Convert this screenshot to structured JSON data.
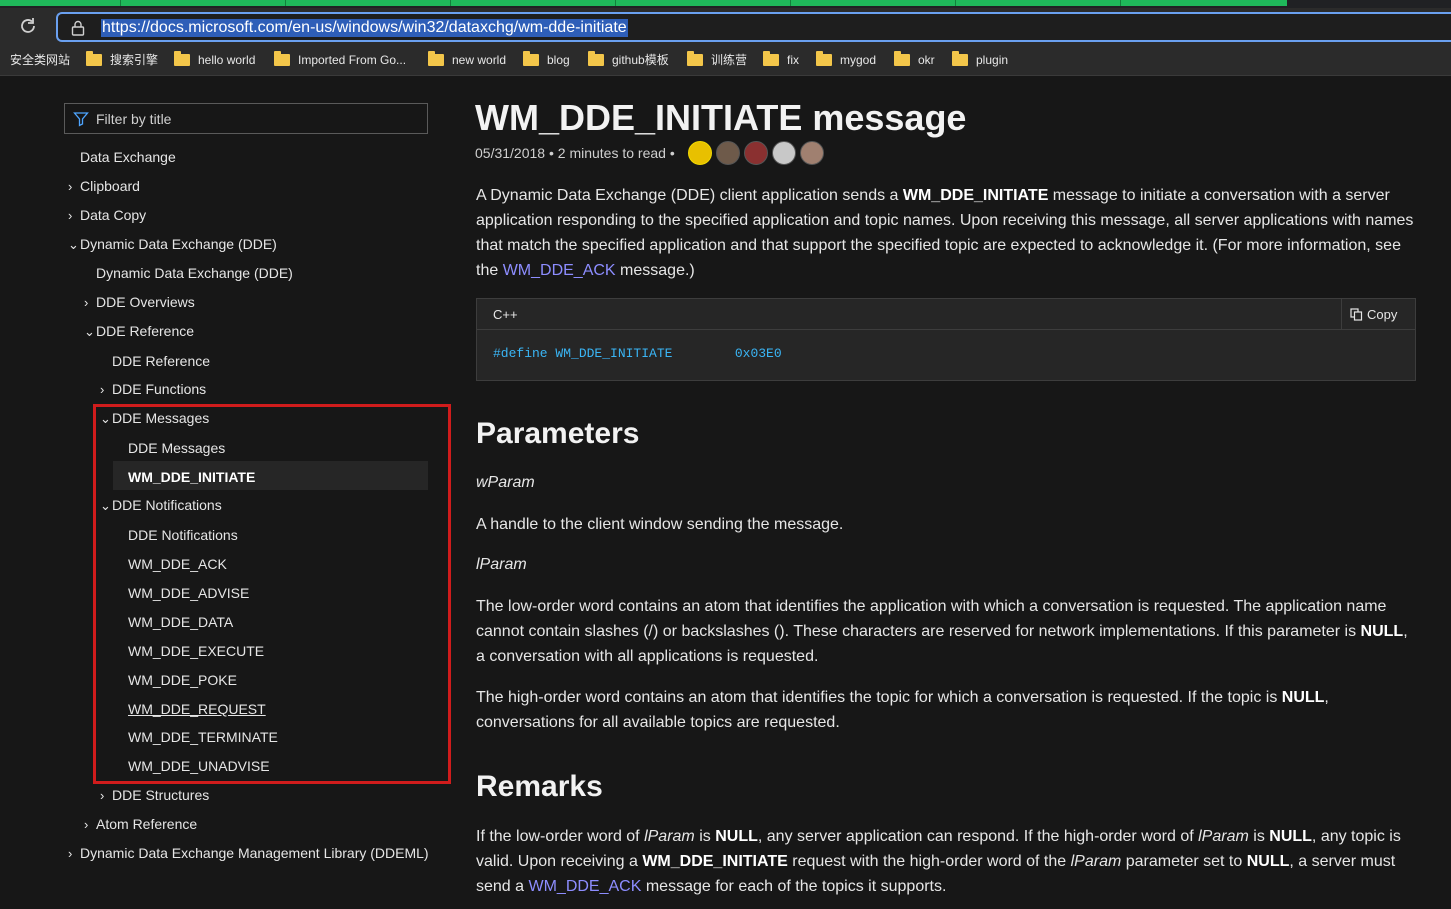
{
  "browser": {
    "url": "https://docs.microsoft.com/en-us/windows/win32/dataxchg/wm-dde-initiate",
    "bookmarks": [
      "安全类网站",
      "搜索引擎",
      "hello world",
      "Imported From Go...",
      "new world",
      "blog",
      "github模板",
      "训练营",
      "fix",
      "mygod",
      "okr",
      "plugin"
    ]
  },
  "sidebar": {
    "filter_placeholder": "Filter by title",
    "items": [
      {
        "label": "Data Exchange",
        "chev": ""
      },
      {
        "label": "Clipboard",
        "chev": "›"
      },
      {
        "label": "Data Copy",
        "chev": "›"
      },
      {
        "label": "Dynamic Data Exchange (DDE)",
        "chev": "⌄"
      },
      {
        "label": "Dynamic Data Exchange (DDE)",
        "chev": ""
      },
      {
        "label": "DDE Overviews",
        "chev": "›"
      },
      {
        "label": "DDE Reference",
        "chev": "⌄"
      },
      {
        "label": "DDE Reference",
        "chev": ""
      },
      {
        "label": "DDE Functions",
        "chev": "›"
      },
      {
        "label": "DDE Messages",
        "chev": "⌄"
      },
      {
        "label": "DDE Messages",
        "chev": ""
      },
      {
        "label": "WM_DDE_INITIATE",
        "chev": ""
      },
      {
        "label": "DDE Notifications",
        "chev": "⌄"
      },
      {
        "label": "DDE Notifications",
        "chev": ""
      },
      {
        "label": "WM_DDE_ACK",
        "chev": ""
      },
      {
        "label": "WM_DDE_ADVISE",
        "chev": ""
      },
      {
        "label": "WM_DDE_DATA",
        "chev": ""
      },
      {
        "label": "WM_DDE_EXECUTE",
        "chev": ""
      },
      {
        "label": "WM_DDE_POKE",
        "chev": ""
      },
      {
        "label": "WM_DDE_REQUEST",
        "chev": ""
      },
      {
        "label": "WM_DDE_TERMINATE",
        "chev": ""
      },
      {
        "label": "WM_DDE_UNADVISE",
        "chev": ""
      },
      {
        "label": "DDE Structures",
        "chev": "›"
      },
      {
        "label": "Atom Reference",
        "chev": "›"
      },
      {
        "label": "Dynamic Data Exchange Management Library (DDEML)",
        "chev": "›"
      }
    ]
  },
  "article": {
    "title": "WM_DDE_INITIATE message",
    "date": "05/31/2018",
    "read_time": "2 minutes to read",
    "intro": {
      "t1": "A Dynamic Data Exchange (DDE) client application sends a ",
      "b1": "WM_DDE_INITIATE",
      "t2": " message to initiate a conversation with a server application responding to the specified application and topic names. Upon receiving this message, all server applications with names that match the specified application and that support the specified topic are expected to acknowledge it. (For more information, see the ",
      "link": "WM_DDE_ACK",
      "t3": " message.)"
    },
    "code": {
      "lang": "C++",
      "copy_label": "Copy",
      "line": "#define WM_DDE_INITIATE        0x03E0"
    },
    "parameters_heading": "Parameters",
    "wparam_name": "wParam",
    "wparam_desc": "A handle to the client window sending the message.",
    "lparam_name": "lParam",
    "lparam_low": {
      "t1": "The low-order word contains an atom that identifies the application with which a conversation is requested. The application name cannot contain slashes (/) or backslashes (). These characters are reserved for network implementations. If this parameter is ",
      "b1": "NULL",
      "t2": ", a conversation with all applications is requested."
    },
    "lparam_high": {
      "t1": "The high-order word contains an atom that identifies the topic for which a conversation is requested. If the topic is ",
      "b1": "NULL",
      "t2": ", conversations for all available topics are requested."
    },
    "remarks_heading": "Remarks",
    "remarks": {
      "t1": "If the low-order word of ",
      "i1": "lParam",
      "t2": " is ",
      "b1": "NULL",
      "t3": ", any server application can respond. If the high-order word of ",
      "i2": "lParam",
      "t4": " is ",
      "b2": "NULL",
      "t5": ", any topic is valid. Upon receiving a ",
      "b3": "WM_DDE_INITIATE",
      "t6": " request with the high-order word of the ",
      "i3": "lParam",
      "t7": " parameter set to ",
      "b4": "NULL",
      "t8": ", a server must send a ",
      "link": "WM_DDE_ACK",
      "t9": " message for each of the topics it supports."
    }
  },
  "colors": {
    "link": "#8d8dff",
    "highlight_box": "#d01c1c",
    "code_text": "#3ab5f5"
  }
}
